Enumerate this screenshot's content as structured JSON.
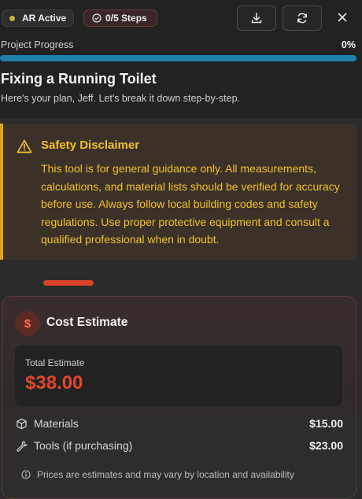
{
  "header": {
    "ar_badge": "AR Active",
    "steps_badge": "0/5 Steps",
    "progress_label": "Project Progress",
    "progress_percent": "0%",
    "progress_value": 0,
    "title": "Fixing a Running Toilet",
    "subtitle": "Here's your plan, Jeff. Let's break it down step-by-step."
  },
  "disclaimer": {
    "title": "Safety Disclaimer",
    "body": "This tool is for general guidance only. All measurements, calculations, and material lists should be verified for accuracy before use. Always follow local building codes and safety regulations. Use proper protective equipment and consult a qualified professional when in doubt."
  },
  "cost": {
    "icon_glyph": "$",
    "title": "Cost Estimate",
    "total_label": "Total Estimate",
    "total_value": "$38.00",
    "items": [
      {
        "label": "Materials",
        "value": "$15.00",
        "icon": "box-icon"
      },
      {
        "label": "Tools (if purchasing)",
        "value": "$23.00",
        "icon": "wrench-icon"
      }
    ],
    "note": "Prices are estimates and may vary by location and availability"
  },
  "colors": {
    "accent": "#e2462c",
    "warning": "#f2c12a",
    "progress": "#1e7fa8"
  }
}
